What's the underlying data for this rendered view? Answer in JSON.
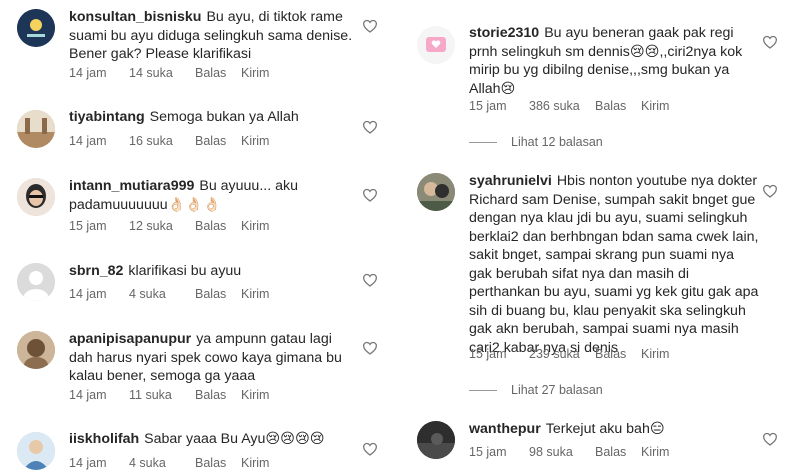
{
  "left": [
    {
      "username": "konsultan_bisnisku",
      "text": "Bu ayu, di tiktok rame suami bu ayu diduga selingkuh sama denise. Bener gak? Please klarifikasi",
      "time": "14 jam",
      "likes": "14 suka",
      "reply": "Balas",
      "send": "Kirim",
      "avatar_color": "#1d3557"
    },
    {
      "username": "tiyabintang",
      "text": "Semoga bukan ya Allah",
      "time": "14 jam",
      "likes": "16 suka",
      "reply": "Balas",
      "send": "Kirim",
      "avatar_color": "#c9b8a0"
    },
    {
      "username": "intann_mutiara999",
      "text": "Bu ayuuu... aku padamuuuuuuu👌🏻👌🏻👌🏻",
      "time": "15 jam",
      "likes": "12 suka",
      "reply": "Balas",
      "send": "Kirim",
      "avatar_color": "#d6c2b6"
    },
    {
      "username": "sbrn_82",
      "text": "klarifikasi bu ayuu",
      "time": "14 jam",
      "likes": "4 suka",
      "reply": "Balas",
      "send": "Kirim",
      "avatar_color": "#d9d9d9"
    },
    {
      "username": "apanipisapanupur",
      "text": "ya ampunn gatau lagi dah harus nyari spek cowo kaya gimana bu kalau bener, semoga ga yaaa",
      "time": "14 jam",
      "likes": "11 suka",
      "reply": "Balas",
      "send": "Kirim",
      "avatar_color": "#b89a7a"
    },
    {
      "username": "iiskholifah",
      "text": "Sabar yaaa Bu Ayu😢😢😢😢",
      "time": "14 jam",
      "likes": "4 suka",
      "reply": "Balas",
      "send": "Kirim",
      "avatar_color": "#a8c6e0"
    }
  ],
  "right": [
    {
      "username": "storie2310",
      "text": "Bu ayu beneran gaak pak regi prnh selingkuh sm dennis😢😢,,ciri2nya kok mirip bu yg dibilng denise,,,smg bukan ya Allah😢",
      "time": "15 jam",
      "likes": "386 suka",
      "reply": "Balas",
      "send": "Kirim",
      "avatar_color": "#f2f2f2",
      "view_replies": "Lihat 12 balasan"
    },
    {
      "username": "syahrunielvi",
      "text": "Hbis nonton youtube nya dokter Richard sam Denise, sumpah sakit bnget gue dengan nya klau jdi bu ayu, suami selingkuh berklai2 dan berhbngan bdan sama cwek lain, sakit bnget, sampai skrang pun suami nya gak berubah sifat nya dan masih di perthankan bu ayu, suami yg kek gitu gak apa sih di buang bu, klau penyakit ska selingkuh gak akn berubah, sampai suami nya masih cari2 kabar nya si denis",
      "time": "15 jam",
      "likes": "239 suka",
      "reply": "Balas",
      "send": "Kirim",
      "avatar_color": "#6b6b5a",
      "view_replies": "Lihat 27 balasan"
    },
    {
      "username": "wanthepur",
      "text": "Terkejut aku bah😑",
      "time": "15 jam",
      "likes": "98 suka",
      "reply": "Balas",
      "send": "Kirim",
      "avatar_color": "#3a3a3a"
    }
  ]
}
